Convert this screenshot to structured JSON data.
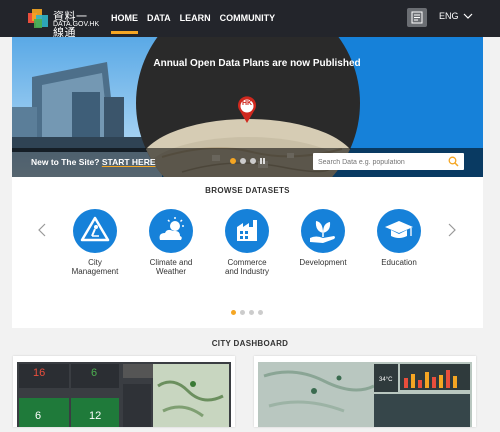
{
  "logo": {
    "zh": "資料一線通",
    "en": "DATA.GOV.HK"
  },
  "nav": [
    "HOME",
    "DATA",
    "LEARN",
    "COMMUNITY"
  ],
  "lang": "ENG",
  "hero": {
    "title": "Annual Open Data Plans are now Published",
    "pin_text": "HK",
    "new_text": "New to The Site?",
    "start_text": "START HERE",
    "search_placeholder": "Search Data e.g. population"
  },
  "browse": {
    "title": "BROWSE DATASETS",
    "categories": [
      {
        "label1": "City",
        "label2": "Management",
        "icon": "worker-sign-icon"
      },
      {
        "label1": "Climate and",
        "label2": "Weather",
        "icon": "sun-cloud-icon"
      },
      {
        "label1": "Commerce",
        "label2": "and Industry",
        "icon": "factory-icon"
      },
      {
        "label1": "Development",
        "label2": "",
        "icon": "plant-hand-icon"
      },
      {
        "label1": "Education",
        "label2": "",
        "icon": "graduation-cap-icon"
      }
    ]
  },
  "city_dashboard": {
    "title": "CITY DASHBOARD",
    "left_tiles": [
      "16",
      "6",
      "6",
      "12"
    ],
    "right_label": "34°C"
  },
  "colors": {
    "accent": "#f5a623",
    "blue": "#1681d9",
    "dark": "#23252b"
  }
}
